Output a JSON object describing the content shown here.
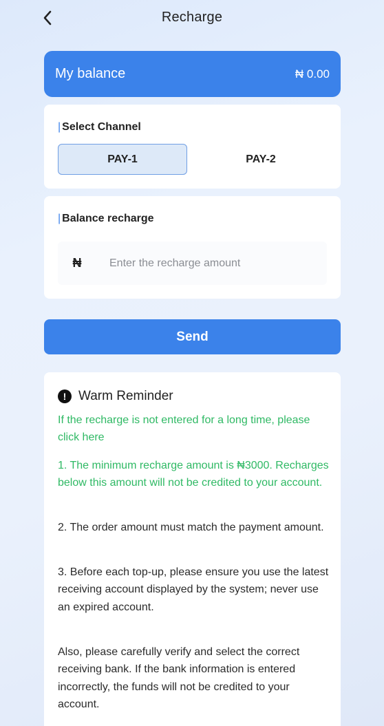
{
  "header": {
    "title": "Recharge",
    "back_icon": "chevron-left-icon"
  },
  "balance": {
    "label": "My balance",
    "value": "₦ 0.00"
  },
  "channel": {
    "title": "Select Channel",
    "options": [
      {
        "label": "PAY-1",
        "selected": true
      },
      {
        "label": "PAY-2",
        "selected": false
      }
    ]
  },
  "recharge": {
    "title": "Balance recharge",
    "currency_symbol": "₦",
    "amount_value": "",
    "amount_placeholder": "Enter the recharge amount"
  },
  "send_label": "Send",
  "reminder": {
    "icon": "exclamation-circle-icon",
    "title": "Warm Reminder",
    "help_link": "If the recharge is not entered for a long time, please click here",
    "rules": [
      "1. The minimum recharge amount is ₦3000. Recharges below this amount will not be credited to your account.",
      "2. The order amount must match the payment amount.",
      "3. Before each top-up, please ensure you use the latest receiving account displayed by the system; never use an expired account.",
      "Also, please carefully verify and select the correct receiving bank. If the bank information is entered incorrectly, the funds will not be credited to your account."
    ]
  },
  "colors": {
    "accent": "#3b82ea",
    "notice_green": "#2fb964",
    "selected_option_bg": "#dde9f8",
    "selected_option_border": "#6f9ee4"
  }
}
